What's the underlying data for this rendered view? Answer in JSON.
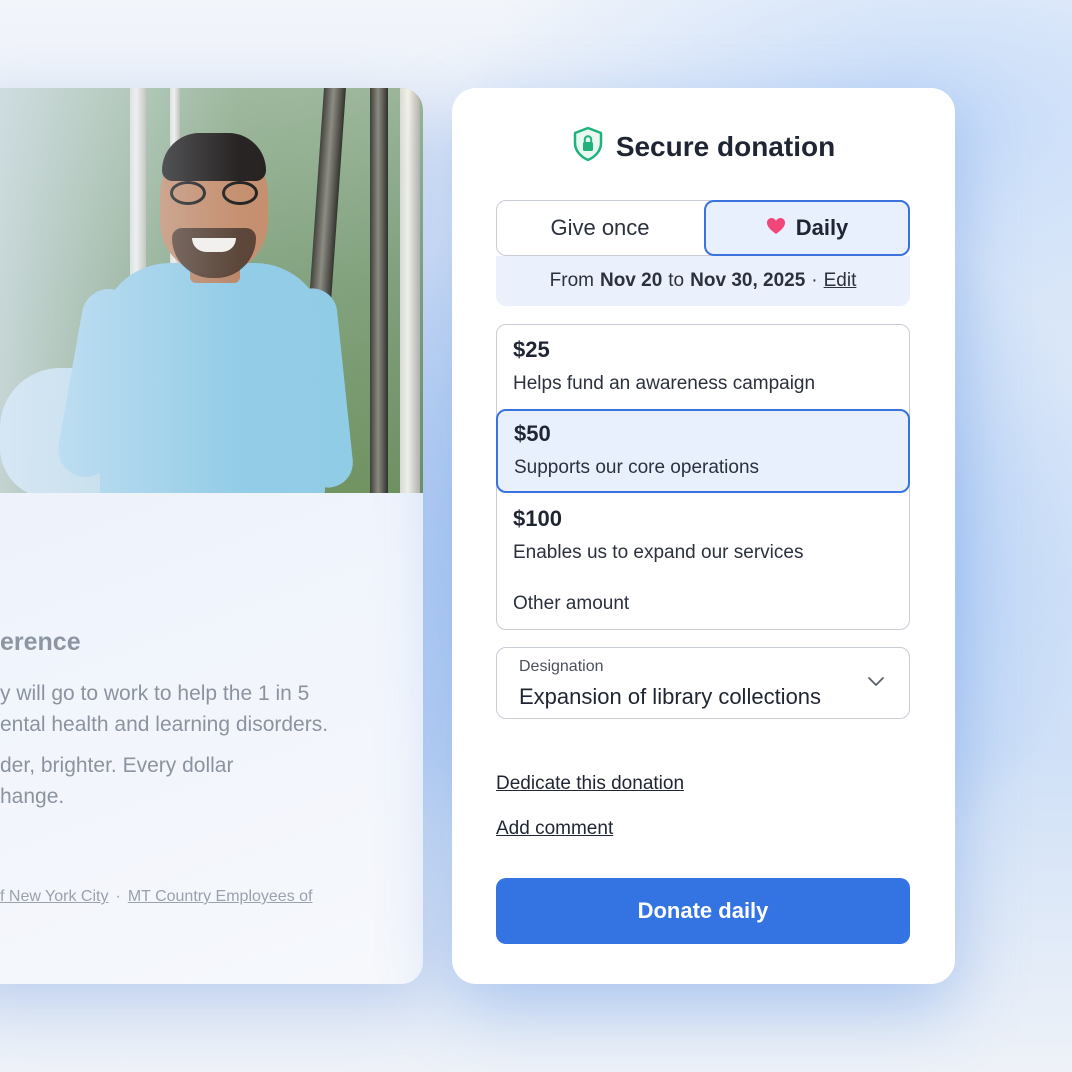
{
  "background_card": {
    "title_fragment": "erence",
    "body_line1": "y will go to work to help the 1 in 5",
    "body_line2": "ental health and learning disorders.",
    "body_line3": "der, brighter. Every dollar",
    "body_line4": "hange.",
    "link1": "f New York City",
    "separator": "·",
    "link2": "MT Country Employees of"
  },
  "header": {
    "title": "Secure donation",
    "icon": "shield-lock-icon",
    "icon_color": "#1fb27d"
  },
  "frequency": {
    "once_label": "Give once",
    "daily_label": "Daily",
    "selected": "Daily",
    "heart_color": "#f0467a"
  },
  "period": {
    "from_label": "From",
    "start": "Nov 20",
    "to_label": "to",
    "end": "Nov 30, 2025",
    "separator": "·",
    "edit_label": "Edit"
  },
  "amounts": [
    {
      "value": "$25",
      "desc": "Helps fund an awareness campaign"
    },
    {
      "value": "$50",
      "desc": "Supports our core operations",
      "selected": true
    },
    {
      "value": "$100",
      "desc": "Enables us to expand our services"
    }
  ],
  "other_amount_label": "Other amount",
  "designation": {
    "label": "Designation",
    "value": "Expansion of library collections"
  },
  "links": {
    "dedicate": "Dedicate this donation",
    "comment": "Add comment"
  },
  "donate_button": "Donate daily",
  "colors": {
    "accent": "#3373e2",
    "selected_bg": "#e9f0fd",
    "shield": "#1fb27d"
  }
}
